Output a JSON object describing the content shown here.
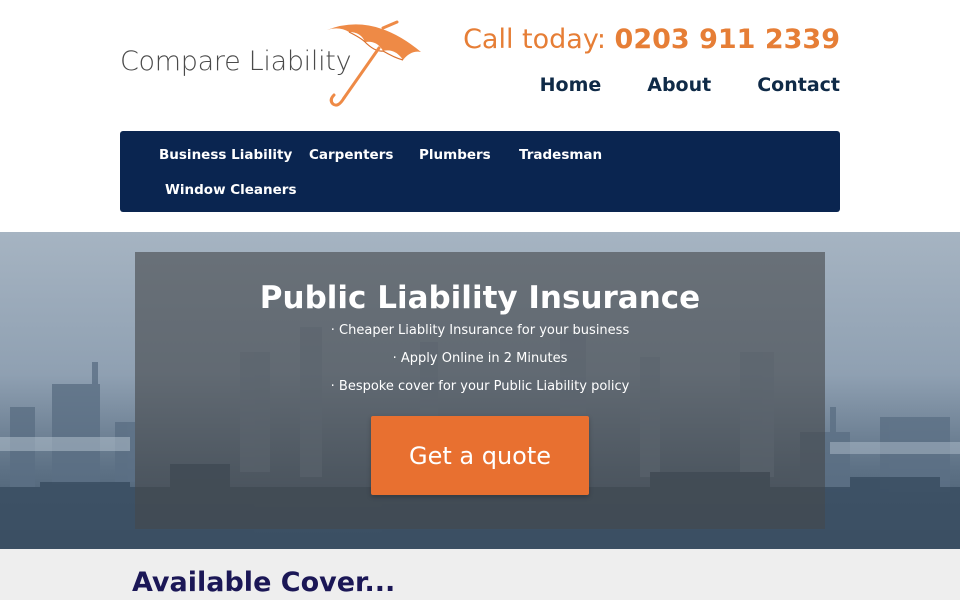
{
  "brand": {
    "logo_text": "Compare Liability"
  },
  "header": {
    "phone_label": "Call today:",
    "phone_number": "0203 911 2339"
  },
  "top_nav": {
    "items": [
      "Home",
      "About",
      "Contact"
    ]
  },
  "main_nav": {
    "items": [
      "Business Liability",
      "Carpenters",
      "Plumbers",
      "Tradesman",
      "Window Cleaners"
    ]
  },
  "hero": {
    "title": "Public Liability Insurance",
    "points": [
      "· Cheaper Liablity Insurance for your business",
      "· Apply Online in 2 Minutes",
      "· Bespoke cover for your Public Liability policy"
    ],
    "cta_label": "Get a quote"
  },
  "cover": {
    "heading": "Available Cover..."
  },
  "colors": {
    "accent": "#e87030",
    "nav_background": "#0a2550",
    "heading": "#1b1756"
  },
  "icons": {
    "logo": "umbrella-icon"
  }
}
